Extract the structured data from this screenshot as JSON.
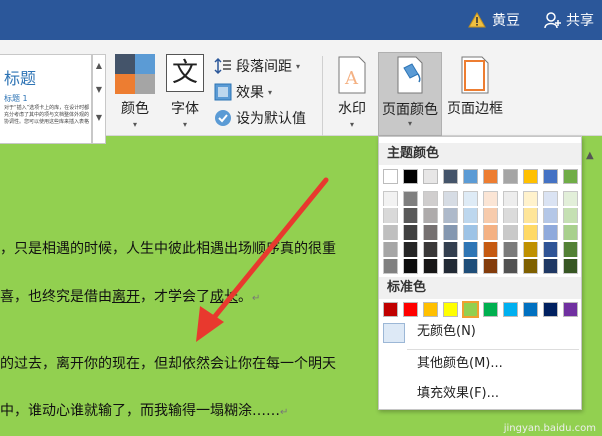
{
  "titlebar": {
    "user": "黄豆",
    "share": "共享"
  },
  "styles_gallery": {
    "heading": "标题",
    "subheading": "标题 1",
    "sample": "对于“插入”选项卡上的库，在设计时都充分考虑了其中的项与文档整体外观的协调性。您可以使用这些库来插入表格"
  },
  "ribbon": {
    "colors_label": "颜色",
    "fonts_label": "字体",
    "fonts_glyph": "文",
    "paragraph_spacing_label": "段落间距",
    "effects_label": "效果",
    "set_default_label": "设为默认值",
    "watermark_label": "水印",
    "page_color_label": "页面颜色",
    "page_borders_label": "页面边框"
  },
  "document": {
    "line1": "，只是相遇的时候，人生中彼此相遇出场顺序真的很重",
    "line2_a": "喜，也终究是借由",
    "line2_link": "离开",
    "line2_b": "，才学会了",
    "line2_link2": "成长",
    "line2_c": "。",
    "line3": "的过去，离开你的现在，但却依然会让你在每一个明天",
    "line4": "中，谁动心谁就输了，而我输得一塌糊涂……",
    "para_mark": "↵"
  },
  "dropdown": {
    "theme_colors_header": "主题颜色",
    "standard_colors_header": "标准色",
    "no_color": "无颜色(N)",
    "more_colors": "其他颜色(M)...",
    "fill_effects": "填充效果(F)...",
    "theme_top": [
      "#ffffff",
      "#000000",
      "#e7e6e6",
      "#44546a",
      "#5b9bd5",
      "#ed7d31",
      "#a5a5a5",
      "#ffc000",
      "#4472c4",
      "#70ad47"
    ],
    "theme_shades": [
      [
        "#f2f2f2",
        "#d9d9d9",
        "#bfbfbf",
        "#a6a6a6",
        "#808080"
      ],
      [
        "#7f7f7f",
        "#595959",
        "#404040",
        "#262626",
        "#0d0d0d"
      ],
      [
        "#d0cece",
        "#aeabab",
        "#757070",
        "#3a3838",
        "#171616"
      ],
      [
        "#d6dce4",
        "#adb9ca",
        "#8497b0",
        "#333f4f",
        "#222a35"
      ],
      [
        "#deebf6",
        "#bdd7ee",
        "#9dc3e6",
        "#2e75b5",
        "#1f4e79"
      ],
      [
        "#fbe5d5",
        "#f7cbac",
        "#f4b183",
        "#c55a11",
        "#833c0b"
      ],
      [
        "#ededed",
        "#dbdbdb",
        "#c9c9c9",
        "#7b7b7b",
        "#525252"
      ],
      [
        "#fff2cc",
        "#fee599",
        "#ffd965",
        "#bf9000",
        "#7f6000"
      ],
      [
        "#dae3f3",
        "#b4c7e7",
        "#8faadc",
        "#2f5496",
        "#1f3864"
      ],
      [
        "#e2efd9",
        "#c5e0b3",
        "#a8d08d",
        "#538135",
        "#375623"
      ]
    ],
    "standard": [
      "#c00000",
      "#ff0000",
      "#ffc000",
      "#ffff00",
      "#92d050",
      "#00b050",
      "#00b0f0",
      "#0070c0",
      "#002060",
      "#7030a0"
    ],
    "selected_standard_index": 4
  },
  "watermark_text": "jingyan.baidu.com"
}
